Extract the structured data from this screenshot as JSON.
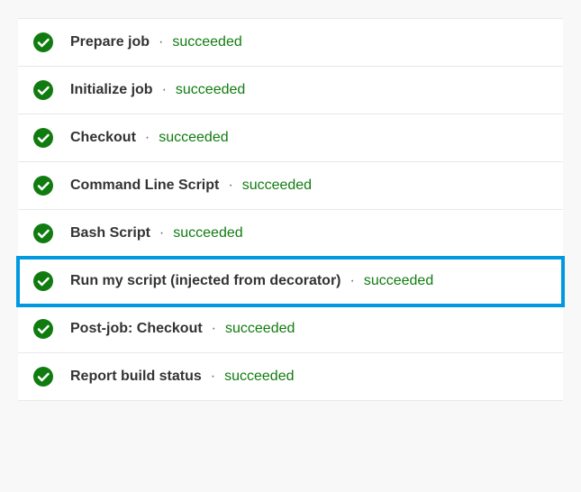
{
  "steps": [
    {
      "name": "Prepare job",
      "status": "succeeded",
      "highlighted": false
    },
    {
      "name": "Initialize job",
      "status": "succeeded",
      "highlighted": false
    },
    {
      "name": "Checkout",
      "status": "succeeded",
      "highlighted": false
    },
    {
      "name": "Command Line Script",
      "status": "succeeded",
      "highlighted": false
    },
    {
      "name": "Bash Script",
      "status": "succeeded",
      "highlighted": false
    },
    {
      "name": "Run my script (injected from decorator)",
      "status": "succeeded",
      "highlighted": true
    },
    {
      "name": "Post-job: Checkout",
      "status": "succeeded",
      "highlighted": false
    },
    {
      "name": "Report build status",
      "status": "succeeded",
      "highlighted": false
    }
  ],
  "separator": "·",
  "colors": {
    "success": "#107c10",
    "highlight": "#0099e0"
  }
}
